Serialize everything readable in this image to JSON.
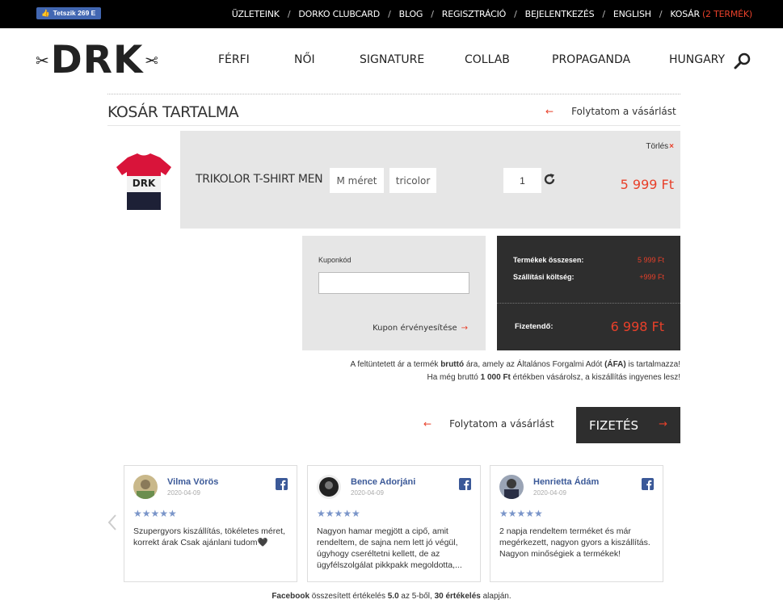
{
  "fb_like": {
    "label": "Tetszik 269 E"
  },
  "toplinks": {
    "stores": "ÜZLETEINK",
    "clubcard": "DORKO CLUBCARD",
    "blog": "BLOG",
    "register": "REGISZTRÁCIÓ",
    "login": "BEJELENTKEZÉS",
    "english": "ENGLISH",
    "cart": "KOSÁR",
    "cart_count": "(2 TERMÉK)"
  },
  "logo": {
    "text": "DRK"
  },
  "nav": {
    "men": "FÉRFI",
    "women": "NŐI",
    "signature": "SIGNATURE",
    "collab": "COLLAB",
    "propaganda": "PROPAGANDA",
    "hungary": "HUNGARY"
  },
  "cart": {
    "title": "KOSÁR TARTALMA",
    "continue_label": "Folytatom a vásárlást",
    "item": {
      "name": "TRIKOLOR T-SHIRT MEN",
      "size": "M méret",
      "color": "tricolor",
      "quantity": "1",
      "price": "5 999 Ft",
      "delete_label": "Törlés"
    }
  },
  "coupon": {
    "label": "Kuponkód",
    "value": "",
    "validate_label": "Kupon érvényesítése"
  },
  "totals": {
    "products_label": "Termékek összesen:",
    "products_value": "5 999 Ft",
    "shipping_label": "Szállítási költség:",
    "shipping_value": "+999 Ft",
    "payable_label": "Fizetendő:",
    "payable_value": "6 998 Ft"
  },
  "notes": {
    "line1_a": "A feltüntetett ár a termék ",
    "line1_b": "bruttó",
    "line1_c": " ára, amely az Általános Forgalmi Adót ",
    "line1_d": "(ÁFA)",
    "line1_e": " is tartalmazza!",
    "line2_a": "Ha még bruttó ",
    "line2_b": "1 000 Ft",
    "line2_c": " értékben vásárolsz, a kiszállítás ingyenes lesz!"
  },
  "actions": {
    "continue_label": "Folytatom a vásárlást",
    "pay_label": "FIZETÉS"
  },
  "reviews": [
    {
      "name": "Vilma Vörös",
      "date": "2020-04-09",
      "stars": "★★★★★",
      "text": "Szupergyors kiszállítás, tökéletes méret, korrekt árak Csak ajánlani tudom🖤"
    },
    {
      "name": "Bence Adorjáni",
      "date": "2020-04-09",
      "stars": "★★★★★",
      "text": "Nagyon hamar megjött a cipő, amit rendeltem, de sajna nem lett jó végül, úgyhogy cseréltetni kellett, de az ügyfélszolgálat pikkpakk megoldotta,..."
    },
    {
      "name": "Henrietta Ádám",
      "date": "2020-04-09",
      "stars": "★★★★★",
      "text": "2 napja rendeltem terméket és már megérkezett, nagyon gyors a kiszállítás. Nagyon minőségiek a termékek!"
    }
  ],
  "summary": {
    "source": "Facebook",
    "text1": " összesített értékelés ",
    "score": "5.0",
    "text2": " az 5-ből, ",
    "count": "30 értékelés",
    "text3": " alapján."
  },
  "colors": {
    "accent": "#e8402a",
    "dark_panel": "#2e2e2e",
    "light_panel": "#e6e6e6",
    "facebook": "#3b5998"
  }
}
